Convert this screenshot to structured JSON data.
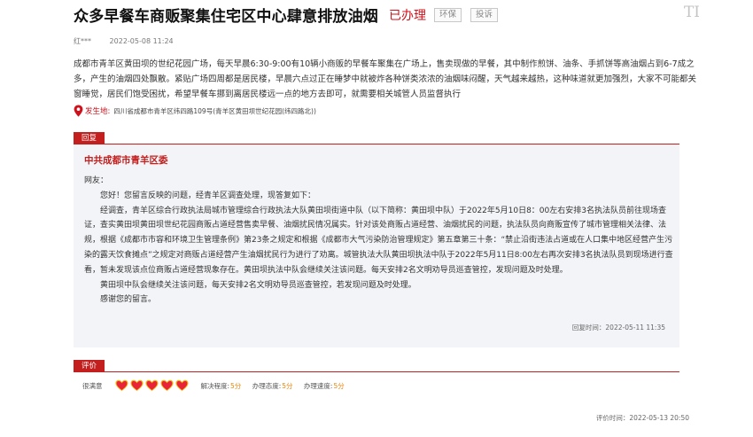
{
  "header": {
    "title": "众多早餐车商贩聚集住宅区中心肆意排放油烟",
    "status": "已办理",
    "tags": [
      "环保",
      "投诉"
    ],
    "corner_mark": "TI"
  },
  "meta": {
    "author": "红***",
    "datetime": "2022-05-08 11:24"
  },
  "complaint": {
    "body": "成都市青羊区黄田坝的世纪花园广场，每天早晨6:30-9:00有10辆小商贩的早餐车聚集在广场上，售卖现做的早餐，其中制作煎饼、油条、手抓饼等高油烟占到6-7成之多，产生的油烟四处飘散。紧贴广场四周都是居民楼，早晨六点过正在睡梦中就被炸各种饼类浓浓的油烟味闷醒，天气越来越热，这种味道就更加强烈，大家不可能都关窗睡觉，居民们饱受困扰，希望早餐车挪到离居民楼远一点的地方去即可，就需要相关城管人员监督执行",
    "location_label": "发生地:",
    "location_value": "四川省成都市青羊区纬四路109号(青羊区黄田坝世纪花园(纬四路北))"
  },
  "reply": {
    "tab_label": "回复",
    "org": "中共成都市青羊区委",
    "greeting": "网友：",
    "paragraphs": [
      "您好！您留言反映的问题，经青羊区调查处理，现答复如下：",
      "经调查，青羊区综合行政执法局城市管理综合行政执法大队黄田坝街道中队（以下简称：黄田坝中队）于2022年5月10日8：00左右安排3名执法队员前往现场查证，查实黄田坝黄田坝世纪花园商贩占道经营售卖早餐、油烟扰民情况属实。针对该处商贩占道经营、油烟扰民的问题，执法队员向商贩宣传了城市管理相关法律、法规，根据《成都市市容和环境卫生管理条例》第23条之规定和根据《成都市大气污染防治管理规定》第五章第三十条：“禁止沿街违法占道或在人口集中地区经营产生污染的露天饮食摊点”之规定对商贩占道经营产生油烟扰民行为进行了劝离。城管执法大队黄田坝执法中队于2022年5月11日8:00左右再次安排3名执法队员到现场进行查看，暂未发现该点位商贩占道经营现象存在。黄田坝执法中队会继续关注该问题。每天安排2名文明劝导员巡查管控，发现问题及时处理。",
      "黄田坝中队会继续关注该问题，每天安排2名文明劝导员巡查管控，若发现问题及时处理。",
      "感谢您的留言。"
    ],
    "time": "回复时间：2022-05-11 11:35"
  },
  "evaluation": {
    "tab_label": "评价",
    "satisfaction": "很满意",
    "rating": 5,
    "scores": [
      {
        "label": "解决程度:",
        "value": "5分"
      },
      {
        "label": "办理态度:",
        "value": "5分"
      },
      {
        "label": "办理速度:",
        "value": "5分"
      }
    ],
    "time": "评价时间：2022-05-13 20:50"
  },
  "colors": {
    "accent_red": "#c31f1f",
    "status_red": "#d0111b",
    "heart_fill": "#e8243a",
    "heart_gold": "#f7b500",
    "score_orange": "#e8860b",
    "reply_bg": "#f3f4f7"
  },
  "icons": [
    "location-pin-icon",
    "heart-rating-icon"
  ]
}
